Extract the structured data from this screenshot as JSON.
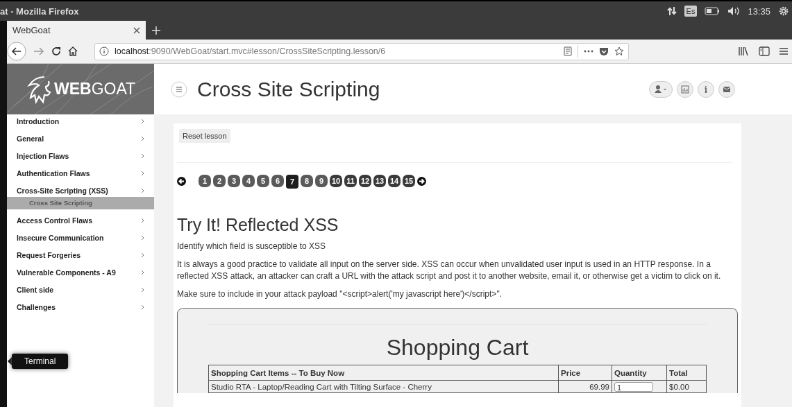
{
  "window": {
    "title": "at - Mozilla Firefox"
  },
  "system_tray": {
    "keyboard_layout": "Es",
    "time": "13:35"
  },
  "tabs": [
    {
      "label": "WebGoat",
      "selected": true
    }
  ],
  "address_bar": {
    "host": "localhost",
    "path": ":9090/WebGoat/start.mvc#lesson/CrossSiteScripting.lesson/6"
  },
  "launcher_tooltip": "Terminal",
  "sidebar": {
    "logo": "**WEB**GOAT",
    "items": [
      {
        "label": "Introduction"
      },
      {
        "label": "General"
      },
      {
        "label": "Injection Flaws"
      },
      {
        "label": "Authentication Flaws"
      },
      {
        "label": "Cross-Site Scripting (XSS)",
        "children": [
          {
            "label": "Cross Site Scripting",
            "selected": true
          }
        ]
      },
      {
        "label": "Access Control Flaws"
      },
      {
        "label": "Insecure Communication"
      },
      {
        "label": "Request Forgeries"
      },
      {
        "label": "Vulnerable Components - A9"
      },
      {
        "label": "Client side"
      },
      {
        "label": "Challenges"
      }
    ]
  },
  "page_title": "Cross Site Scripting",
  "reset_button": "Reset lesson",
  "pages": [
    {
      "label": "1",
      "selected": false
    },
    {
      "label": "2",
      "selected": false
    },
    {
      "label": "3",
      "selected": false
    },
    {
      "label": "4",
      "selected": false
    },
    {
      "label": "5",
      "selected": false
    },
    {
      "label": "6",
      "selected": false
    },
    {
      "label": "7",
      "selected": true
    },
    {
      "label": "8",
      "selected": false
    },
    {
      "label": "9",
      "selected": false
    },
    {
      "label": "10",
      "selected": false
    },
    {
      "label": "11",
      "selected": false
    },
    {
      "label": "12",
      "selected": false
    },
    {
      "label": "13",
      "selected": false
    },
    {
      "label": "14",
      "selected": false
    },
    {
      "label": "15",
      "selected": false
    }
  ],
  "lesson": {
    "heading": "Try It! Reflected XSS",
    "paragraphs": [
      "Identify which field is susceptible to XSS",
      "It is always a good practice to validate all input on the server side. XSS can occur when unvalidated user input is used in an HTTP response. In a reflected XSS attack, an attacker can craft a URL with the attack script and post it to another website, email it, or otherwise get a victim to click on it.",
      "Make sure to include in your attack payload \"<script>alert('my javascript here')</script>\"."
    ]
  },
  "cart": {
    "title": "Shopping Cart",
    "columns": [
      "Shopping Cart Items -- To Buy Now",
      "Price",
      "Quantity",
      "Total"
    ],
    "rows": [
      {
        "item": "Studio RTA - Laptop/Reading Cart with Tilting Surface - Cherry",
        "price": "69.99",
        "quantity": "1",
        "total": "$0.00"
      }
    ]
  }
}
